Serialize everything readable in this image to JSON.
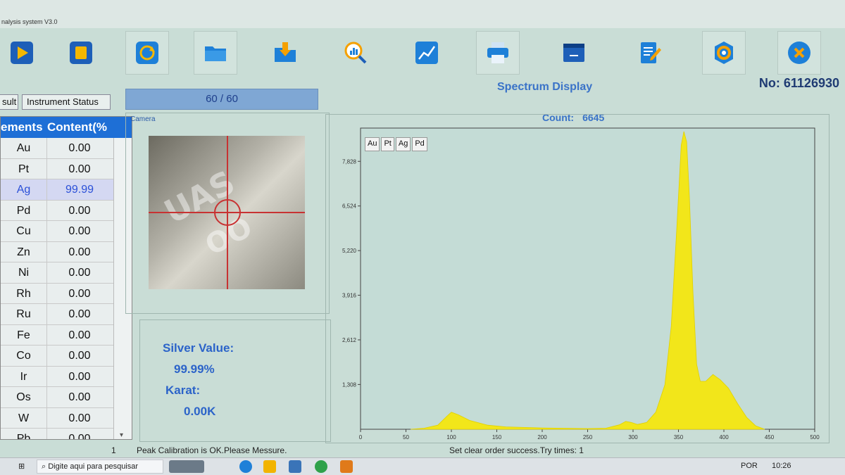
{
  "window": {
    "title": "nalysis system V3.0"
  },
  "toolbar": {
    "buttons": [
      {
        "name": "start",
        "icon": "play-icon"
      },
      {
        "name": "stop",
        "icon": "stop-icon"
      },
      {
        "name": "refresh",
        "icon": "refresh-icon"
      },
      {
        "name": "open",
        "icon": "folder-icon"
      },
      {
        "name": "import",
        "icon": "download-folder-icon"
      },
      {
        "name": "search",
        "icon": "search-chart-icon"
      },
      {
        "name": "curve",
        "icon": "line-chart-icon"
      },
      {
        "name": "print",
        "icon": "printer-icon"
      },
      {
        "name": "window",
        "icon": "window-icon"
      },
      {
        "name": "report",
        "icon": "edit-document-icon"
      },
      {
        "name": "settings",
        "icon": "gear-icon"
      },
      {
        "name": "close",
        "icon": "close-icon"
      }
    ]
  },
  "header": {
    "number": "No: 61126930"
  },
  "tabs": {
    "result": "sult",
    "status": "Instrument Status"
  },
  "progress": {
    "text": "60 / 60"
  },
  "elements": {
    "col_name": "ements",
    "col_content": "Content(%",
    "rows": [
      {
        "name": "Au",
        "value": "0.00"
      },
      {
        "name": "Pt",
        "value": "0.00"
      },
      {
        "name": "Ag",
        "value": "99.99"
      },
      {
        "name": "Pd",
        "value": "0.00"
      },
      {
        "name": "Cu",
        "value": "0.00"
      },
      {
        "name": "Zn",
        "value": "0.00"
      },
      {
        "name": "Ni",
        "value": "0.00"
      },
      {
        "name": "Rh",
        "value": "0.00"
      },
      {
        "name": "Ru",
        "value": "0.00"
      },
      {
        "name": "Fe",
        "value": "0.00"
      },
      {
        "name": "Co",
        "value": "0.00"
      },
      {
        "name": "Ir",
        "value": "0.00"
      },
      {
        "name": "Os",
        "value": "0.00"
      },
      {
        "name": "W",
        "value": "0.00"
      },
      {
        "name": "Pb",
        "value": "0.00"
      }
    ]
  },
  "camera": {
    "label": "Camera",
    "stamp": "UAS",
    "stamp2": "OO"
  },
  "values": {
    "silver_label": "Silver Value:",
    "silver_value": "99.99%",
    "karat_label": "Karat:",
    "karat_value": "0.00K"
  },
  "spectrum": {
    "title": "Spectrum Display",
    "count_label": "Count:",
    "count_value": "6645",
    "legend": [
      "Au",
      "Pt",
      "Ag",
      "Pd"
    ]
  },
  "chart_data": {
    "type": "area",
    "xlim": [
      0,
      500
    ],
    "x_ticks": [
      0,
      50,
      100,
      150,
      200,
      250,
      300,
      350,
      400,
      450,
      500
    ],
    "y_ticks": [
      "1,308",
      "2,612",
      "3,916",
      "5,220",
      "6,524",
      "7,828"
    ],
    "ylim": [
      0,
      8800
    ],
    "series": [
      {
        "color": "#f2e61a",
        "points": [
          [
            55,
            0
          ],
          [
            70,
            30
          ],
          [
            85,
            120
          ],
          [
            95,
            380
          ],
          [
            100,
            500
          ],
          [
            108,
            420
          ],
          [
            120,
            260
          ],
          [
            140,
            120
          ],
          [
            160,
            70
          ],
          [
            200,
            40
          ],
          [
            250,
            20
          ],
          [
            270,
            30
          ],
          [
            285,
            130
          ],
          [
            292,
            230
          ],
          [
            298,
            200
          ],
          [
            305,
            140
          ],
          [
            315,
            200
          ],
          [
            325,
            500
          ],
          [
            335,
            1300
          ],
          [
            342,
            3000
          ],
          [
            348,
            5800
          ],
          [
            353,
            8300
          ],
          [
            356,
            8700
          ],
          [
            359,
            8400
          ],
          [
            362,
            6800
          ],
          [
            366,
            4000
          ],
          [
            370,
            1900
          ],
          [
            374,
            1400
          ],
          [
            380,
            1400
          ],
          [
            388,
            1600
          ],
          [
            396,
            1450
          ],
          [
            405,
            1200
          ],
          [
            415,
            750
          ],
          [
            425,
            350
          ],
          [
            435,
            100
          ],
          [
            445,
            0
          ]
        ]
      }
    ]
  },
  "status": {
    "cell": "1",
    "message": "Peak Calibration is OK.Please Messure.",
    "right_message": "Set clear order success.Try times: 1"
  },
  "taskbar": {
    "search_placeholder": "Digite aqui para pesquisar",
    "lang": "POR",
    "time": "10:26"
  }
}
